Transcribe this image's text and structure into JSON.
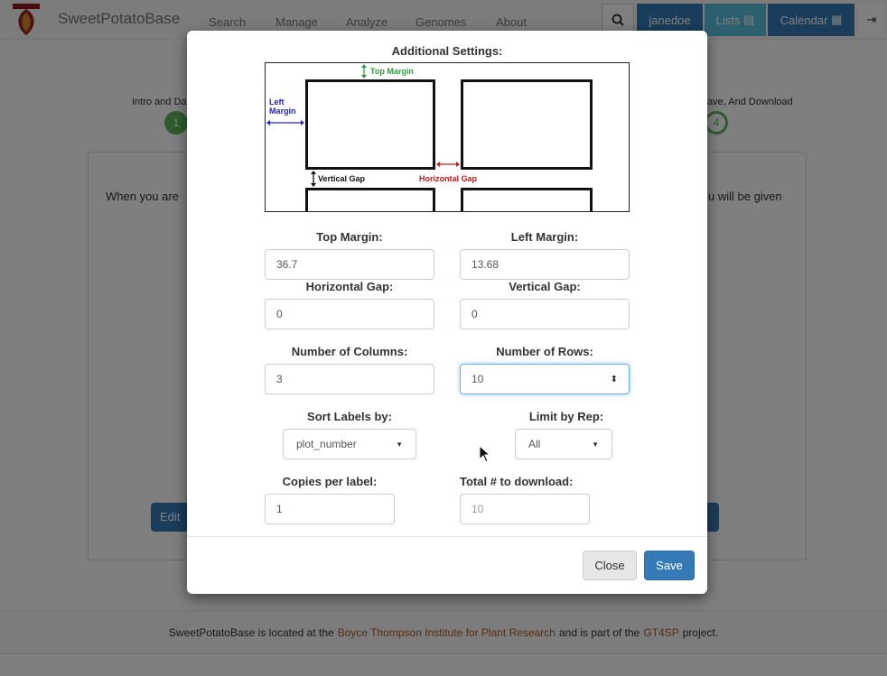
{
  "navbar": {
    "brand": "SweetPotatoBase",
    "links": [
      "Search",
      "Manage",
      "Analyze",
      "Genomes",
      "About"
    ],
    "search_icon": "search-icon",
    "user": "janedoe",
    "lists": "Lists",
    "lists_icon": "list-icon",
    "calendar": "Calendar",
    "calendar_icon": "calendar-icon",
    "logout_icon": "logout-icon",
    "logo_text": "GT4SP"
  },
  "wizard": {
    "step1": "Intro and Dat",
    "step1_num": "1",
    "step4": "ave, And Download",
    "step4_num": "4"
  },
  "panel": {
    "text_left": "When you are",
    "text_right": "u will be given",
    "edit": "Edit"
  },
  "footer": {
    "prefix": "SweetPotatoBase is located at the",
    "link1": "Boyce Thompson Institute for Plant Research",
    "middle": "and is part of the",
    "link2": "GT4SP",
    "suffix": "project."
  },
  "modal": {
    "title": "Additional Settings:",
    "diagram": {
      "top_margin": "Top Margin",
      "left_margin_1": "Left",
      "left_margin_2": "Margin",
      "vertical_gap": "Vertical Gap",
      "horizontal_gap": "Horizontal Gap"
    },
    "top_margin_label": "Top Margin:",
    "top_margin_value": "36.7",
    "left_margin_label": "Left Margin:",
    "left_margin_value": "13.68",
    "horizontal_gap_label": "Horizontal Gap:",
    "horizontal_gap_value": "0",
    "vertical_gap_label": "Vertical Gap:",
    "vertical_gap_value": "0",
    "columns_label": "Number of Columns:",
    "columns_value": "3",
    "rows_label": "Number of Rows:",
    "rows_value": "10",
    "sort_label": "Sort Labels by:",
    "sort_value": "plot_number",
    "rep_label": "Limit by Rep:",
    "rep_value": "All",
    "copies_label": "Copies per label:",
    "copies_value": "1",
    "total_label": "Total # to download:",
    "total_value": "10",
    "close": "Close",
    "save": "Save"
  },
  "colors": {
    "primary": "#337ab7",
    "info": "#5bc0de",
    "success": "#5cb85c",
    "link": "#b35d1e",
    "diagram_green": "#2e9d3a",
    "diagram_blue": "#2323c8",
    "diagram_red": "#d01818"
  }
}
